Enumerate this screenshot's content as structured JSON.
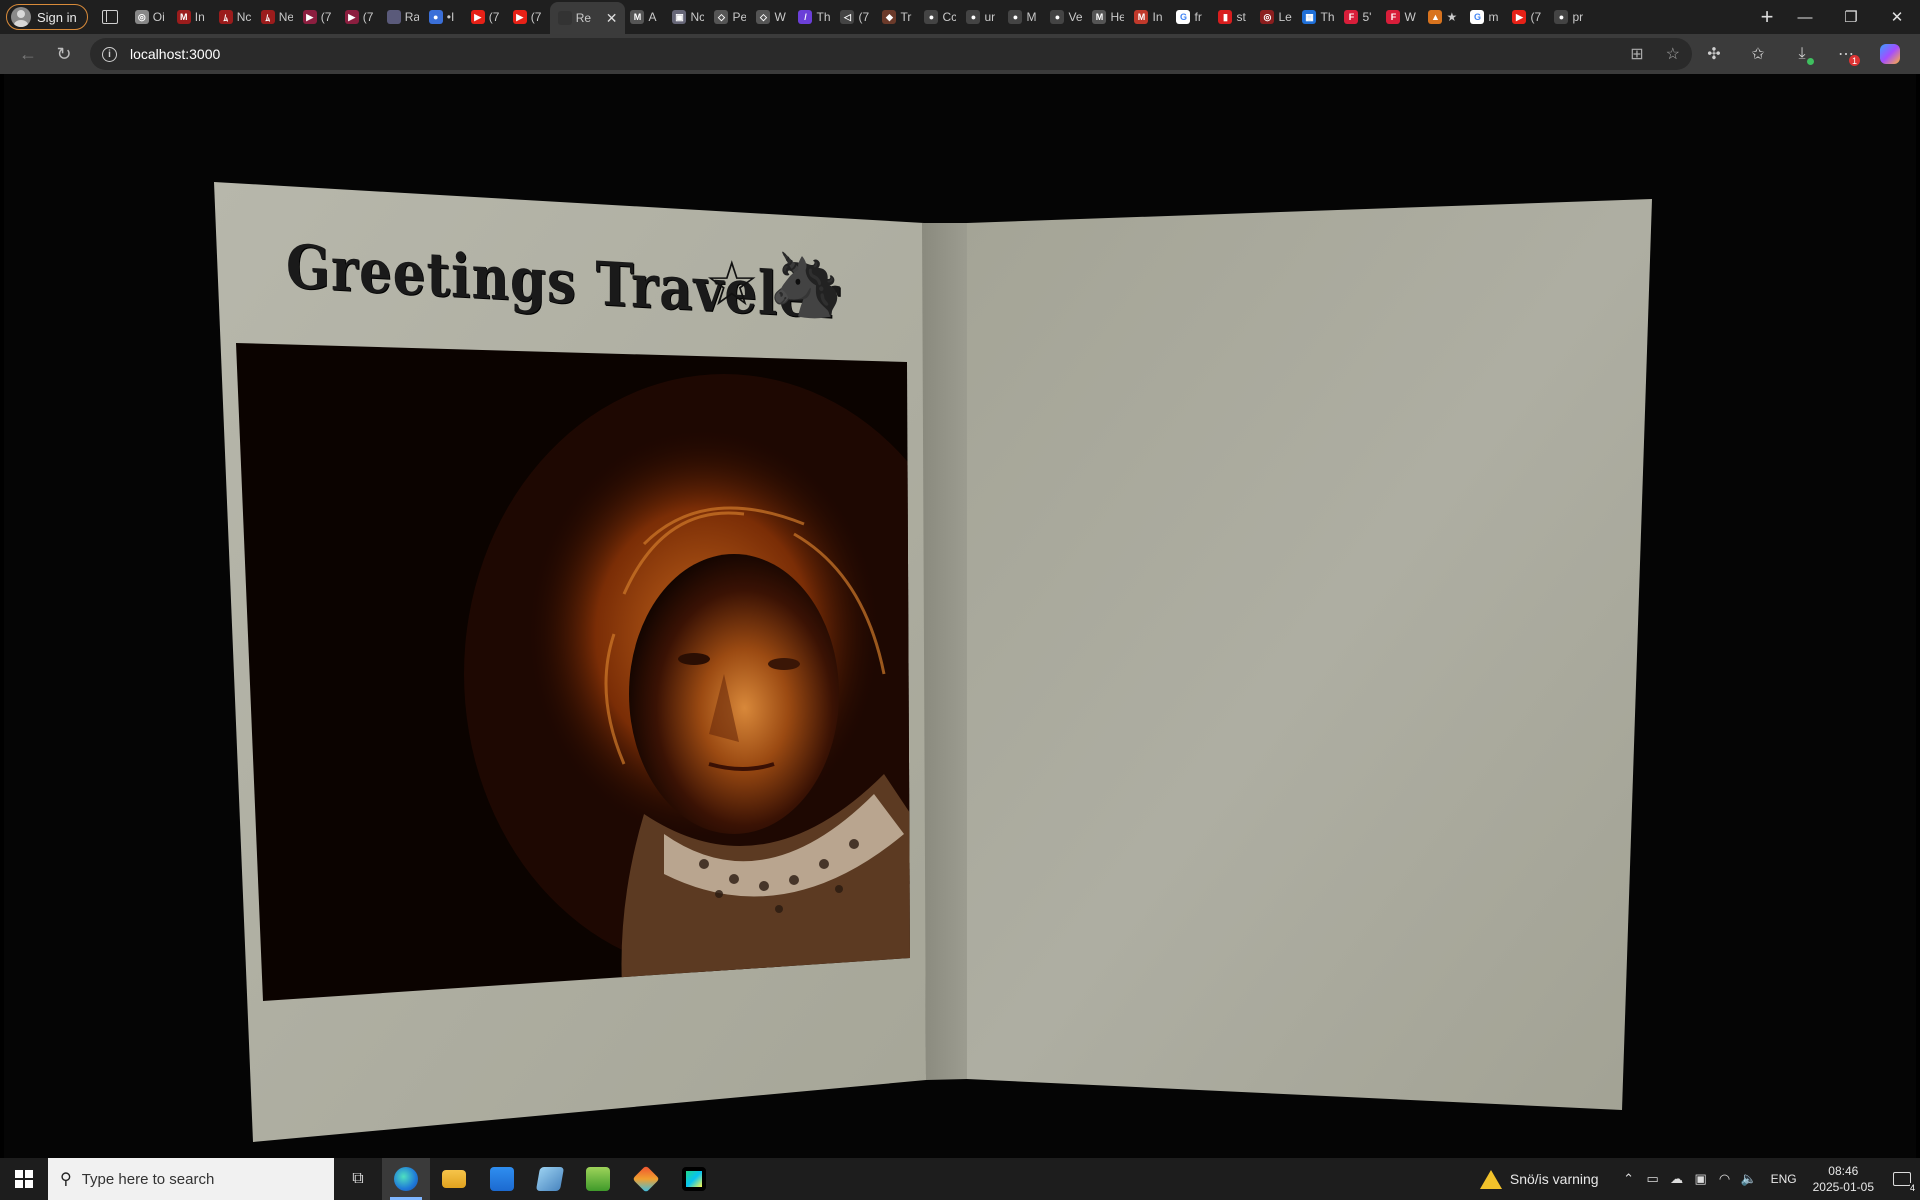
{
  "browser": {
    "signin_label": "Sign in",
    "tabs": [
      {
        "short": "Oi",
        "color": "#888888",
        "glyph": "◎"
      },
      {
        "short": "In",
        "color": "#9b1c1c",
        "glyph": "M"
      },
      {
        "short": "Nc",
        "color": "#9b1c1c",
        "glyph": "ﾑ"
      },
      {
        "short": "Ne",
        "color": "#9b1c1c",
        "glyph": "ﾑ"
      },
      {
        "short": "(7",
        "color": "#8b1e3f",
        "glyph": "▶"
      },
      {
        "short": "(7",
        "color": "#8b1e3f",
        "glyph": "▶"
      },
      {
        "short": "Ra",
        "color": "#5a5a7a",
        "glyph": ""
      },
      {
        "short": "•I",
        "color": "#3a6fd8",
        "glyph": "●"
      },
      {
        "short": "(7",
        "color": "#e62117",
        "glyph": "▶"
      },
      {
        "short": "(7",
        "color": "#e62117",
        "glyph": "▶"
      },
      {
        "short": "Re",
        "color": "#333333",
        "glyph": "",
        "active": true
      },
      {
        "short": "A",
        "color": "#555555",
        "glyph": "M"
      },
      {
        "short": "Nc",
        "color": "#666677",
        "glyph": "▣"
      },
      {
        "short": "Pe",
        "color": "#555555",
        "glyph": "◇"
      },
      {
        "short": "W",
        "color": "#555555",
        "glyph": "◇"
      },
      {
        "short": "Th",
        "color": "#6b3fd8",
        "glyph": "/"
      },
      {
        "short": "(7",
        "color": "#444444",
        "glyph": "◁"
      },
      {
        "short": "Tr",
        "color": "#6b3a2a",
        "glyph": "◆"
      },
      {
        "short": "Cc",
        "color": "#444444",
        "glyph": "●"
      },
      {
        "short": "ur",
        "color": "#444444",
        "glyph": "●"
      },
      {
        "short": "M",
        "color": "#444444",
        "glyph": "●"
      },
      {
        "short": "Ve",
        "color": "#444444",
        "glyph": "●"
      },
      {
        "short": "He",
        "color": "#555555",
        "glyph": "M"
      },
      {
        "short": "In",
        "color": "#c0392b",
        "glyph": "M"
      },
      {
        "short": "fr",
        "color": "#ffffff",
        "glyph": "G"
      },
      {
        "short": "st",
        "color": "#d81e1e",
        "glyph": "▮"
      },
      {
        "short": "Le",
        "color": "#8b1e1e",
        "glyph": "◎"
      },
      {
        "short": "Th",
        "color": "#1e6fd8",
        "glyph": "▦"
      },
      {
        "short": "5'",
        "color": "#d81e3a",
        "glyph": "F"
      },
      {
        "short": "W",
        "color": "#d81e3a",
        "glyph": "F"
      },
      {
        "short": "★",
        "color": "#d8731e",
        "glyph": "▲"
      },
      {
        "short": "m",
        "color": "#ffffff",
        "glyph": "G"
      },
      {
        "short": "(7",
        "color": "#e62117",
        "glyph": "▶"
      },
      {
        "short": "pr",
        "color": "#444444",
        "glyph": "●"
      }
    ],
    "url": "localhost:3000"
  },
  "card": {
    "greeting": "Greetings Traveler",
    "star_icon": "☆",
    "unicorn_icon": "🦄",
    "photo_alt": "Portrait photo of a young man with tousled reddish hair and a patterned scarf, lit warmly against a dark background"
  },
  "taskbar": {
    "search_placeholder": "Type here to search",
    "weather_text": "Snö/is varning",
    "lang": "ENG",
    "time": "08:46",
    "date": "2025-01-05",
    "notif_count": "4"
  }
}
